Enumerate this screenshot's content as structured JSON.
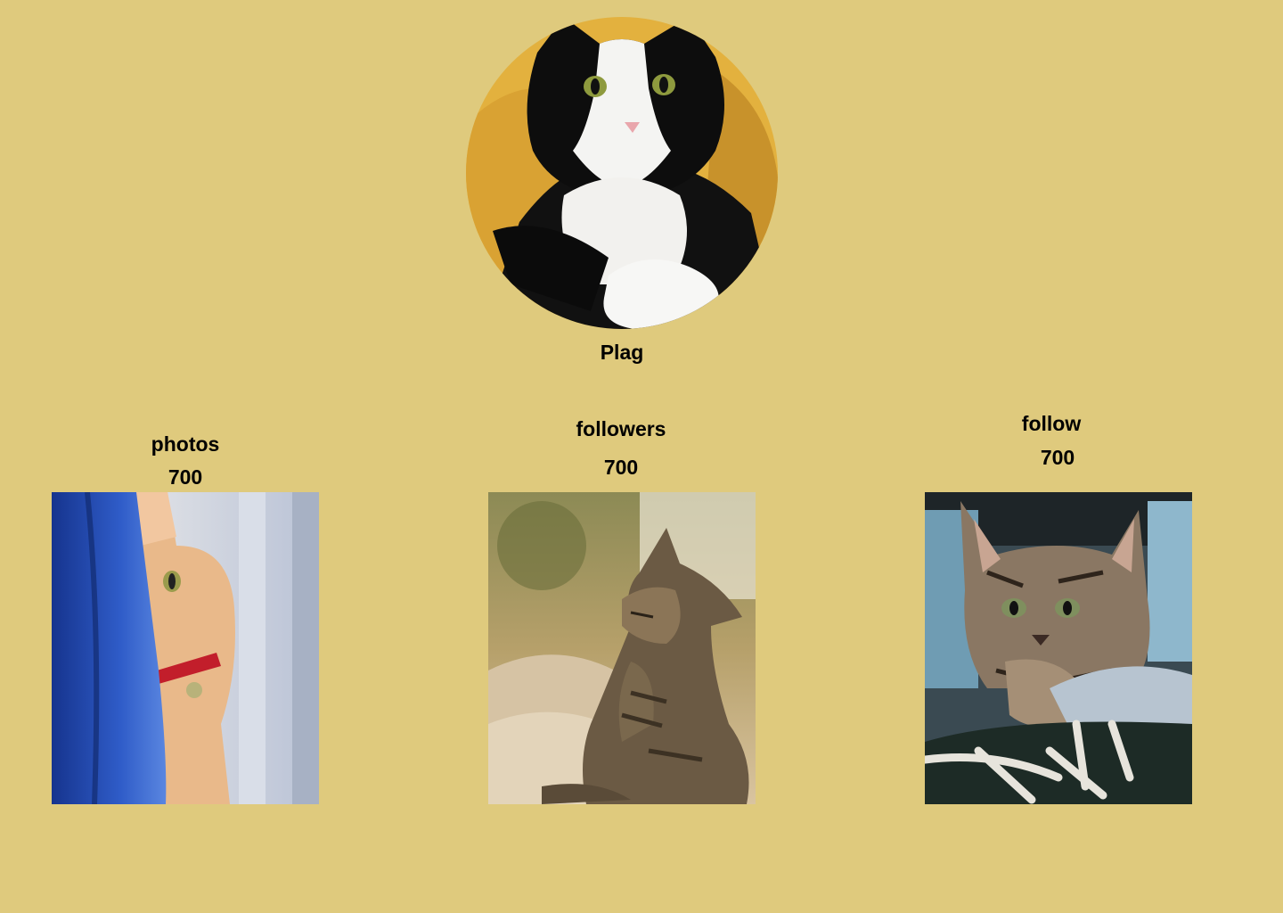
{
  "profile": {
    "name": "Plag",
    "avatar_icon": "black-white-cat-photo"
  },
  "stats": [
    {
      "label": "photos",
      "value": "700",
      "image_icon": "ginger-cat-behind-curtain-photo"
    },
    {
      "label": "followers",
      "value": "700",
      "image_icon": "tabby-cat-grooming-photo"
    },
    {
      "label": "follow",
      "value": "700",
      "image_icon": "tabby-kitten-on-sneaker-photo"
    }
  ],
  "colors": {
    "background": "#DFCA7D",
    "text": "#000000"
  }
}
